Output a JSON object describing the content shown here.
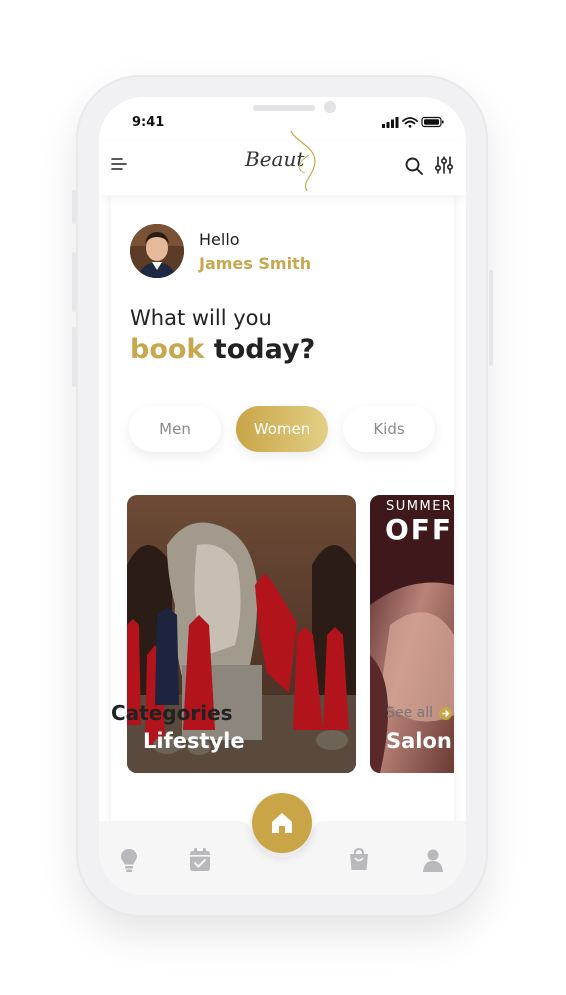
{
  "status_bar": {
    "time": "9:41"
  },
  "header": {
    "logo_text": "Beaut"
  },
  "greeting": {
    "hello": "Hello",
    "name": "James Smith"
  },
  "headline": {
    "line1": "What will you",
    "accent": "book",
    "rest": " today?"
  },
  "segments": {
    "items": [
      "Men",
      "Women",
      "Kids"
    ],
    "selected": "Women"
  },
  "cards": [
    {
      "label": "Lifestyle"
    },
    {
      "label": "Salon",
      "promo_top": "SUMMER",
      "promo_big": "OFF"
    }
  ],
  "categories": {
    "title": "Categories",
    "see_all": "See all"
  },
  "bottom_nav": {
    "items": [
      "lightbulb-icon",
      "calendar-check-icon",
      "home-icon",
      "shopping-bag-icon",
      "user-icon"
    ],
    "active": "home-icon"
  },
  "colors": {
    "accent": "#c9a74f",
    "text": "#222222",
    "muted": "#8a8a8a"
  }
}
